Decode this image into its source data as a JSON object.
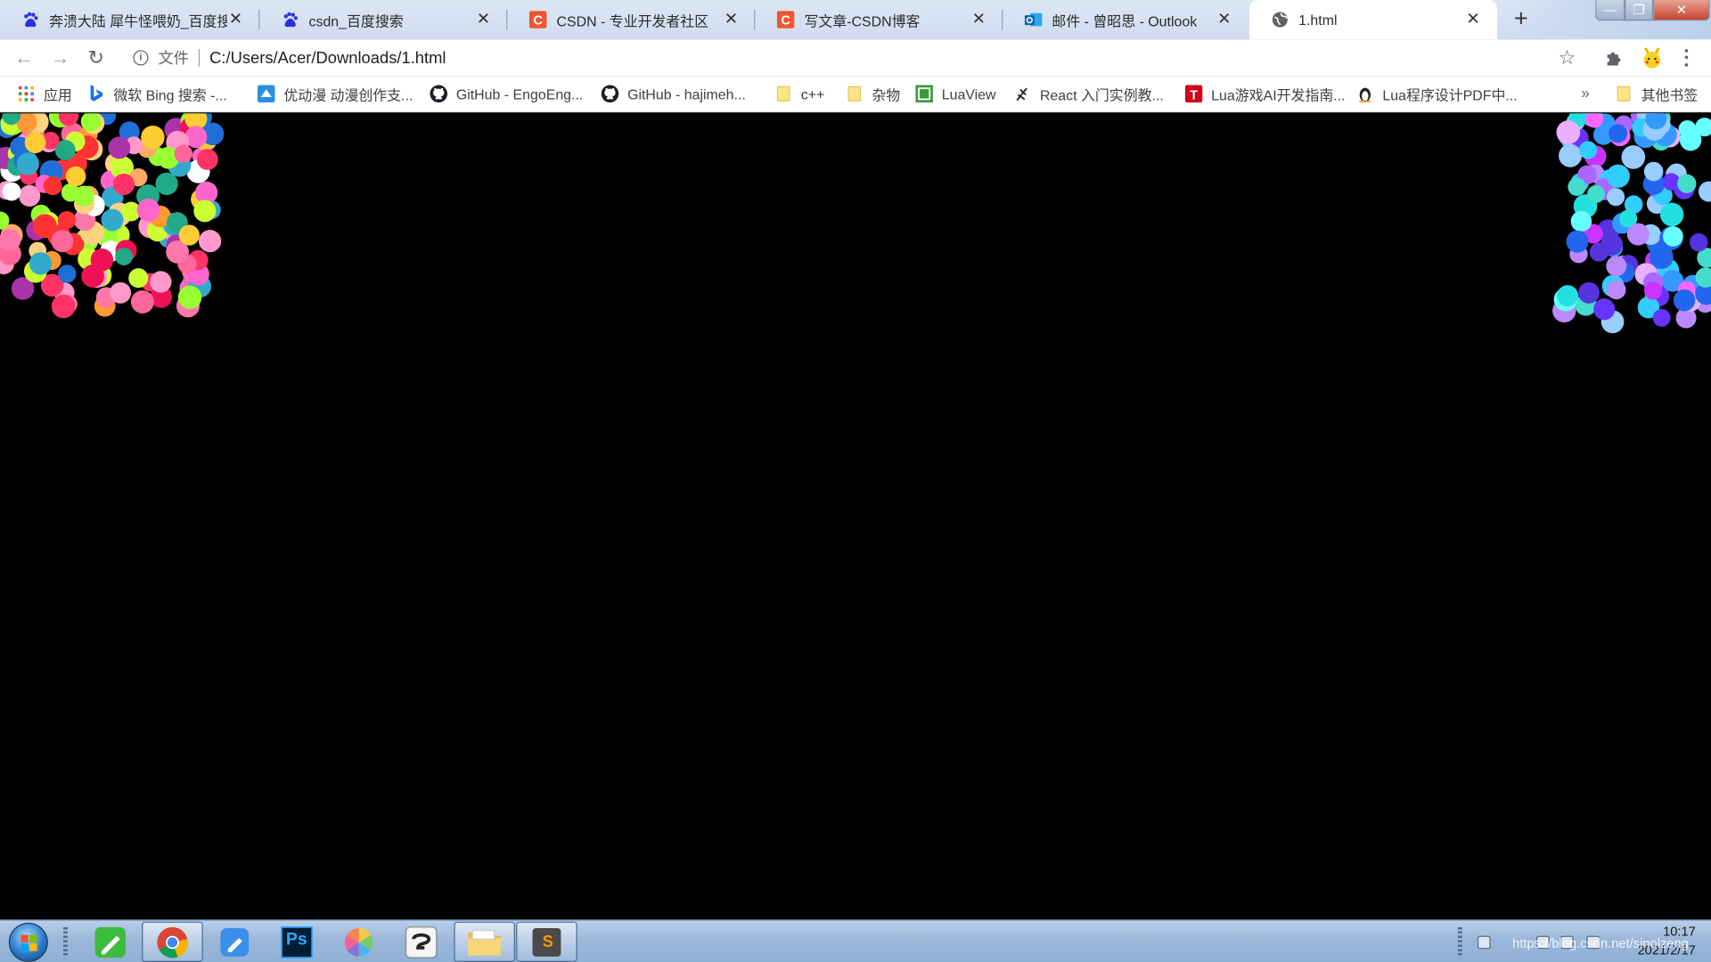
{
  "browser": {
    "tabs": [
      {
        "title": "奔溃大陆 犀牛怪喂奶_百度搜索",
        "icon": "baidu-paw-icon"
      },
      {
        "title": "csdn_百度搜索",
        "icon": "baidu-paw-icon"
      },
      {
        "title": "CSDN - 专业开发者社区",
        "icon": "csdn-logo-icon"
      },
      {
        "title": "写文章-CSDN博客",
        "icon": "csdn-logo-icon"
      },
      {
        "title": "邮件 - 曾昭思 - Outlook",
        "icon": "outlook-icon"
      },
      {
        "title": "1.html",
        "icon": "globe-icon",
        "active": true
      }
    ],
    "new_tab": "+",
    "close_glyph": "✕",
    "window_controls": {
      "minimize": "—",
      "maximize": "❐",
      "close": "✕"
    },
    "toolbar": {
      "back": "←",
      "forward": "→",
      "reload": "↻",
      "info": "i",
      "scheme_label": "文件",
      "url": "C:/Users/Acer/Downloads/1.html",
      "star": "☆"
    },
    "bookmarks": [
      {
        "label": "应用",
        "icon": "apps-grid-icon"
      },
      {
        "label": "微软 Bing 搜索 -...",
        "icon": "bing-icon"
      },
      {
        "label": "优动漫 动漫创作支...",
        "icon": "youdongman-icon"
      },
      {
        "label": "GitHub - EngoEng...",
        "icon": "github-icon"
      },
      {
        "label": "GitHub - hajimeh...",
        "icon": "github-icon"
      },
      {
        "label": "c++",
        "icon": "folder-icon"
      },
      {
        "label": "杂物",
        "icon": "folder-icon"
      },
      {
        "label": "LuaView",
        "icon": "luaview-icon"
      },
      {
        "label": "React 入门实例教...",
        "icon": "react-ruanyifeng-icon"
      },
      {
        "label": "Lua游戏AI开发指南...",
        "icon": "t-logo-icon"
      },
      {
        "label": "Lua程序设计PDF中...",
        "icon": "penguin-icon"
      }
    ],
    "bookmarks_overflow": "»",
    "other_bookmarks": "其他书签"
  },
  "page": {
    "background": "#000000",
    "palette": [
      "#ff3366",
      "#ff9933",
      "#ffcc33",
      "#33ccff",
      "#ff66cc",
      "#99ff33",
      "#cc33ff",
      "#ff6699",
      "#3366ff",
      "#ffffff",
      "#ff3333",
      "#66ffcc",
      "#ffaa66",
      "#aa33aa",
      "#33aacc",
      "#ff99cc",
      "#ccff33",
      "#6633ff",
      "#ff5500",
      "#00ccaa"
    ],
    "left_palette": [
      "#ff3366",
      "#ff9933",
      "#ffcc33",
      "#ff66cc",
      "#99ff33",
      "#ff6699",
      "#ffffff",
      "#ff3333",
      "#ffaa66",
      "#aa33aa",
      "#ff99cc",
      "#ccff33",
      "#33aacc",
      "#ffd27f",
      "#ee1155",
      "#22aa88",
      "#1f6fd6",
      "#ff77aa"
    ],
    "right_palette": [
      "#33ccff",
      "#cc33ff",
      "#6633ff",
      "#66ffff",
      "#aa66ff",
      "#3399ff",
      "#ff66ff",
      "#99ccff",
      "#22e0e0",
      "#bb88ff",
      "#5533dd",
      "#2266ee",
      "#e8b0ff",
      "#44ddcc"
    ]
  },
  "taskbar": {
    "apps": [
      {
        "name": "start-orb",
        "active": false
      },
      {
        "name": "evernote-like-green-app-icon",
        "active": false
      },
      {
        "name": "chrome-icon",
        "active": true
      },
      {
        "name": "blue-pen-app-icon",
        "active": false
      },
      {
        "name": "photoshop-icon",
        "active": false,
        "label": "Ps"
      },
      {
        "name": "color-wheel-app-icon",
        "active": false
      },
      {
        "name": "clip-studio-icon",
        "active": false
      },
      {
        "name": "file-explorer-icon",
        "active": true
      },
      {
        "name": "sublime-text-icon",
        "active": true,
        "label": "S"
      }
    ],
    "clock_time": "10:17",
    "clock_date": "2021/2/17",
    "watermark": "https://blog.csdn.net/sinolzeng"
  }
}
